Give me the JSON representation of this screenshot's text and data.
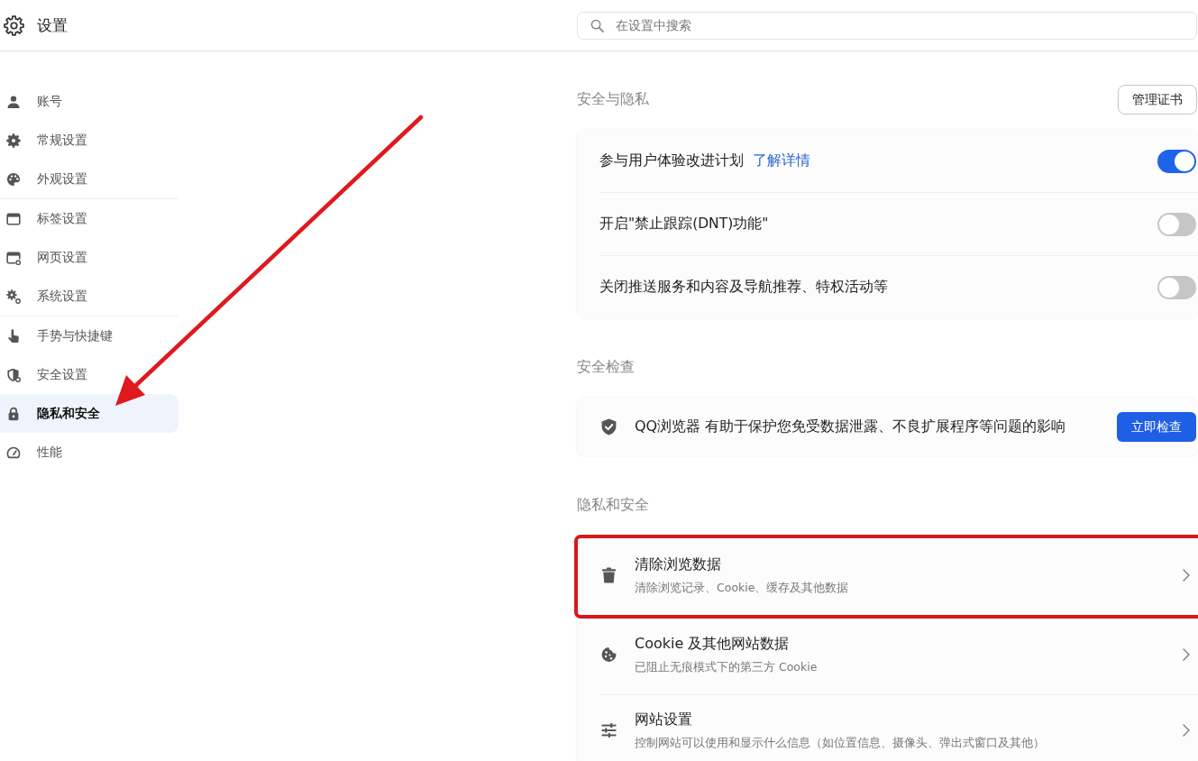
{
  "header": {
    "title": "设置",
    "search": {
      "placeholder": "在设置中搜索"
    }
  },
  "sidebar": {
    "groups": [
      {
        "items": [
          {
            "label": "账号",
            "selected": false
          },
          {
            "label": "常规设置",
            "selected": false
          },
          {
            "label": "外观设置",
            "selected": false
          }
        ]
      },
      {
        "items": [
          {
            "label": "标签设置",
            "selected": false
          },
          {
            "label": "网页设置",
            "selected": false
          },
          {
            "label": "系统设置",
            "selected": false
          }
        ]
      },
      {
        "items": [
          {
            "label": "手势与快捷键",
            "selected": false
          },
          {
            "label": "安全设置",
            "selected": false
          },
          {
            "label": "隐私和安全",
            "selected": true
          },
          {
            "label": "性能",
            "selected": false
          }
        ]
      }
    ]
  },
  "sections": [
    {
      "title": "安全与隐私",
      "action": "管理证书",
      "rows": [
        {
          "kind": "toggle",
          "label": "参与用户体验改进计划",
          "link": "了解详情",
          "on": true
        },
        {
          "kind": "toggle",
          "label": "开启\"禁止跟踪(DNT)功能\"",
          "on": false
        },
        {
          "kind": "toggle",
          "label": "关闭推送服务和内容及导航推荐、特权活动等",
          "on": false
        }
      ]
    },
    {
      "title": "安全检查",
      "rows": [
        {
          "kind": "check",
          "label": "QQ浏览器 有助于保护您免受数据泄露、不良扩展程序等问题的影响",
          "button": "立即检查"
        }
      ]
    },
    {
      "title": "隐私和安全",
      "rows": [
        {
          "kind": "nav",
          "label": "清除浏览数据",
          "description": "清除浏览记录、Cookie、缓存及其他数据",
          "highlighted": true
        },
        {
          "kind": "nav",
          "label": "Cookie 及其他网站数据",
          "description": "已阻止无痕模式下的第三方 Cookie",
          "highlighted": false
        },
        {
          "kind": "nav",
          "label": "网站设置",
          "description": "控制网站可以使用和显示什么信息（如位置信息、摄像头、弹出式窗口及其他）",
          "highlighted": false
        }
      ]
    }
  ]
}
